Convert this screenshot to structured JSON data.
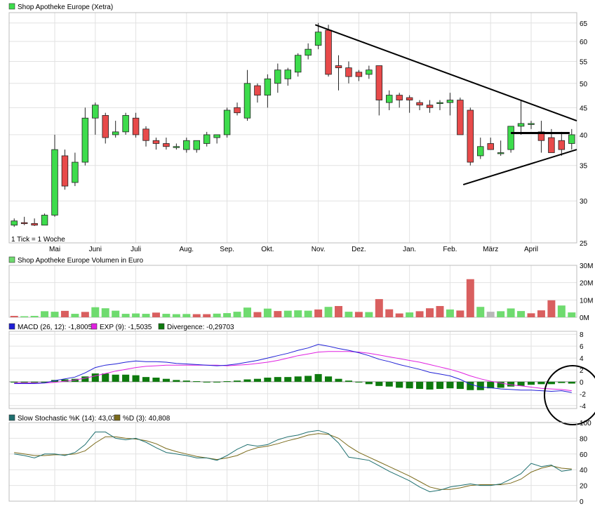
{
  "chart_data": [
    {
      "type": "candlestick",
      "title": "Shop Apotheke Europe (Xetra)",
      "legend_color": "#3ddc4c",
      "up_color": "#3ddc4c",
      "down_color": "#e84a4a",
      "footnote": "1 Tick = 1 Woche",
      "ylim": [
        25,
        68
      ],
      "log_scale": true,
      "y_ticks": [
        25,
        30,
        35,
        40,
        45,
        50,
        55,
        60,
        65
      ],
      "x_labels": [
        "Mai",
        "Juni",
        "Juli",
        "Aug.",
        "Sep.",
        "Okt.",
        "Nov.",
        "Dez.",
        "Jan.",
        "Feb.",
        "März",
        "April"
      ],
      "x_label_weeks": [
        4.5,
        8.5,
        12.5,
        17.5,
        21.5,
        25.5,
        30.5,
        34.5,
        39.5,
        43.5,
        47.5,
        51.5
      ],
      "weeks": 56,
      "ohlc": [
        [
          27.0,
          27.8,
          26.8,
          27.5
        ],
        [
          27.3,
          28.0,
          27.0,
          27.2
        ],
        [
          27.2,
          27.8,
          26.9,
          27.0
        ],
        [
          27.0,
          28.4,
          27.0,
          28.2
        ],
        [
          28.2,
          40.0,
          28.0,
          37.5
        ],
        [
          36.5,
          37.5,
          31.5,
          32.0
        ],
        [
          32.5,
          37.0,
          32.0,
          35.5
        ],
        [
          35.5,
          45.0,
          35.0,
          43.0
        ],
        [
          43.0,
          46.0,
          40.0,
          45.5
        ],
        [
          43.5,
          44.0,
          38.5,
          39.5
        ],
        [
          40.0,
          42.5,
          39.5,
          40.5
        ],
        [
          40.5,
          44.0,
          40.0,
          43.5
        ],
        [
          43.0,
          44.0,
          39.5,
          40.0
        ],
        [
          41.0,
          41.5,
          38.0,
          39.0
        ],
        [
          39.0,
          39.5,
          37.5,
          38.5
        ],
        [
          38.5,
          39.5,
          37.5,
          38.0
        ],
        [
          38.0,
          38.5,
          37.5,
          38.0
        ],
        [
          37.5,
          39.5,
          37.0,
          39.0
        ],
        [
          37.5,
          38.5,
          37.0,
          39.0
        ],
        [
          38.5,
          40.5,
          38.0,
          40.0
        ],
        [
          39.5,
          40.0,
          38.5,
          40.0
        ],
        [
          40.0,
          45.0,
          39.5,
          44.5
        ],
        [
          45.0,
          46.0,
          43.5,
          44.0
        ],
        [
          43.0,
          53.0,
          42.5,
          50.0
        ],
        [
          49.5,
          50.0,
          46.0,
          47.5
        ],
        [
          47.5,
          52.0,
          45.0,
          51.0
        ],
        [
          50.0,
          54.5,
          48.0,
          53.0
        ],
        [
          51.0,
          53.5,
          49.5,
          53.0
        ],
        [
          52.5,
          57.0,
          51.5,
          56.5
        ],
        [
          56.5,
          59.5,
          55.5,
          58.0
        ],
        [
          59.0,
          65.0,
          58.0,
          62.5
        ],
        [
          63.0,
          64.5,
          51.5,
          52.0
        ],
        [
          54.0,
          56.5,
          48.5,
          53.5
        ],
        [
          53.5,
          55.0,
          50.0,
          51.5
        ],
        [
          52.5,
          53.0,
          50.5,
          51.5
        ],
        [
          52.0,
          54.0,
          51.0,
          53.0
        ],
        [
          54.0,
          54.0,
          43.5,
          46.5
        ],
        [
          46.0,
          48.5,
          44.5,
          47.5
        ],
        [
          47.5,
          48.0,
          45.0,
          46.5
        ],
        [
          47.0,
          47.5,
          44.0,
          46.5
        ],
        [
          46.0,
          46.5,
          44.5,
          45.5
        ],
        [
          45.5,
          46.5,
          44.0,
          45.0
        ],
        [
          46.0,
          46.5,
          44.5,
          46.0
        ],
        [
          46.0,
          48.0,
          43.5,
          46.5
        ],
        [
          46.5,
          47.0,
          40.5,
          40.0
        ],
        [
          44.5,
          45.0,
          35.0,
          35.5
        ],
        [
          36.5,
          39.5,
          36.0,
          38.0
        ],
        [
          38.5,
          39.5,
          37.5,
          37.5
        ],
        [
          37.0,
          39.0,
          36.5,
          37.0
        ],
        [
          37.5,
          41.5,
          37.0,
          41.5
        ],
        [
          41.5,
          46.5,
          40.0,
          42.0
        ],
        [
          42.0,
          42.5,
          41.0,
          42.0
        ],
        [
          40.5,
          42.5,
          37.0,
          39.0
        ],
        [
          39.5,
          41.0,
          38.0,
          37.0
        ],
        [
          39.0,
          40.5,
          36.5,
          37.5
        ],
        [
          38.5,
          41.0,
          37.5,
          40.0
        ]
      ],
      "trendlines": [
        {
          "from": [
            30.2,
            64.5
          ],
          "to": [
            56,
            42.5
          ]
        },
        {
          "from": [
            44.8,
            32.2
          ],
          "to": [
            56,
            37.5
          ]
        },
        {
          "from": [
            49.5,
            40.3
          ],
          "to": [
            55.3,
            40.3
          ]
        }
      ]
    },
    {
      "type": "bar",
      "title": "Shop Apotheke Europe Volumen in Euro",
      "legend_color": "#6fdb6f",
      "y_ticks": [
        "0M",
        "10M",
        "20M",
        "30M"
      ],
      "ylim": [
        0,
        30
      ],
      "unit": "M",
      "values": [
        0.8,
        0.6,
        0.8,
        3.5,
        3.2,
        3.7,
        2.0,
        3.1,
        5.8,
        5.2,
        3.8,
        2.0,
        2.2,
        2.0,
        2.7,
        2.0,
        1.8,
        1.9,
        1.8,
        1.8,
        2.1,
        2.4,
        3.2,
        5.6,
        3.0,
        5.0,
        3.6,
        3.8,
        4.0,
        3.8,
        4.5,
        6.0,
        6.5,
        3.2,
        3.1,
        3.0,
        10.5,
        4.6,
        2.2,
        2.8,
        3.5,
        5.2,
        6.5,
        4.5,
        3.9,
        22.0,
        6.0,
        3.2,
        3.5,
        5.1,
        3.6,
        2.3,
        4.0,
        9.8,
        6.8,
        2.8
      ],
      "colors": [
        "r",
        "g",
        "g",
        "g",
        "g",
        "r",
        "g",
        "r",
        "g",
        "g",
        "g",
        "g",
        "g",
        "g",
        "r",
        "g",
        "g",
        "g",
        "r",
        "r",
        "g",
        "g",
        "g",
        "g",
        "r",
        "g",
        "r",
        "g",
        "g",
        "g",
        "r",
        "g",
        "r",
        "g",
        "r",
        "g",
        "r",
        "r",
        "r",
        "g",
        "r",
        "r",
        "r",
        "g",
        "r",
        "r",
        "g",
        "x",
        "g",
        "g",
        "g",
        "r",
        "r",
        "r",
        "g",
        "g"
      ]
    },
    {
      "type": "line",
      "series_labels": [
        {
          "text": "MACD (26, 12): -1,8005",
          "color": "#1f1fd6"
        },
        {
          "text": "EXP (9): -1,5035",
          "color": "#e020e0"
        },
        {
          "text": "Divergence: -0,29703",
          "color": "#0e7a0e"
        }
      ],
      "y_ticks": [
        "-4",
        "-2",
        "0",
        "2",
        "4",
        "6",
        "8"
      ],
      "ylim": [
        -4.5,
        8.5
      ],
      "macd": [
        -0.3,
        -0.3,
        -0.3,
        -0.2,
        0.2,
        0.5,
        0.8,
        1.5,
        2.4,
        2.8,
        3.0,
        3.3,
        3.5,
        3.4,
        3.4,
        3.3,
        3.1,
        3.0,
        2.9,
        2.8,
        2.7,
        2.8,
        3.0,
        3.3,
        3.6,
        4.0,
        4.4,
        4.8,
        5.3,
        5.7,
        6.3,
        6.0,
        5.6,
        5.3,
        4.9,
        4.4,
        3.8,
        3.4,
        2.9,
        2.5,
        2.1,
        1.6,
        1.3,
        1.0,
        0.4,
        -0.4,
        -0.9,
        -1.0,
        -1.2,
        -1.3,
        -1.4,
        -1.4,
        -1.5,
        -1.6,
        -1.5,
        -1.8
      ],
      "exp": [
        -0.2,
        -0.2,
        -0.2,
        -0.2,
        -0.1,
        0.1,
        0.3,
        0.6,
        1.0,
        1.4,
        1.8,
        2.1,
        2.4,
        2.6,
        2.7,
        2.8,
        2.8,
        2.8,
        2.8,
        2.8,
        2.8,
        2.7,
        2.8,
        2.9,
        3.1,
        3.3,
        3.6,
        4.0,
        4.4,
        4.7,
        5.0,
        5.1,
        5.1,
        5.1,
        5.0,
        4.8,
        4.5,
        4.2,
        3.9,
        3.6,
        3.3,
        2.9,
        2.5,
        2.1,
        1.6,
        1.0,
        0.5,
        0.1,
        -0.2,
        -0.5,
        -0.7,
        -0.9,
        -1.1,
        -1.2,
        -1.3,
        -1.5
      ],
      "divergence": [
        -0.1,
        -0.1,
        -0.1,
        0.0,
        0.3,
        0.4,
        0.5,
        0.9,
        1.4,
        1.4,
        1.2,
        1.2,
        1.1,
        0.8,
        0.7,
        0.5,
        0.3,
        0.2,
        0.1,
        0.0,
        -0.1,
        0.1,
        0.2,
        0.4,
        0.5,
        0.7,
        0.8,
        0.8,
        0.9,
        1.0,
        1.3,
        0.9,
        0.5,
        0.2,
        -0.1,
        -0.4,
        -0.7,
        -0.8,
        -1.0,
        -1.1,
        -1.2,
        -1.3,
        -1.2,
        -1.1,
        -1.2,
        -1.4,
        -1.4,
        -1.1,
        -1.0,
        -0.8,
        -0.7,
        -0.5,
        -0.4,
        -0.4,
        -0.2,
        -0.3
      ]
    },
    {
      "type": "line",
      "series_labels": [
        {
          "text": "Slow Stochastic %K (14): 43,03",
          "color": "#1e6f6f"
        },
        {
          "text": "%D (3): 40,808",
          "color": "#7a6a1a"
        }
      ],
      "y_ticks": [
        "0",
        "20",
        "40",
        "60",
        "80",
        "100"
      ],
      "ylim": [
        0,
        100
      ],
      "k": [
        60,
        58,
        55,
        60,
        60,
        58,
        62,
        72,
        88,
        88,
        80,
        78,
        80,
        75,
        68,
        62,
        60,
        58,
        55,
        55,
        52,
        58,
        66,
        72,
        70,
        72,
        78,
        82,
        84,
        88,
        90,
        86,
        74,
        56,
        54,
        52,
        45,
        38,
        32,
        26,
        18,
        12,
        14,
        18,
        20,
        22,
        20,
        20,
        22,
        28,
        35,
        48,
        44,
        46,
        38,
        40
      ],
      "d": [
        62,
        60,
        58,
        58,
        59,
        59,
        60,
        64,
        74,
        82,
        82,
        80,
        79,
        77,
        73,
        67,
        63,
        60,
        57,
        55,
        53,
        55,
        58,
        64,
        68,
        70,
        73,
        77,
        80,
        84,
        86,
        85,
        80,
        70,
        62,
        56,
        50,
        44,
        38,
        32,
        25,
        18,
        15,
        15,
        17,
        20,
        21,
        21,
        21,
        23,
        28,
        37,
        42,
        45,
        42,
        41
      ]
    }
  ],
  "annotations": [
    {
      "type": "circle",
      "panel": "macd",
      "note": "highlighted end of MACD"
    }
  ]
}
